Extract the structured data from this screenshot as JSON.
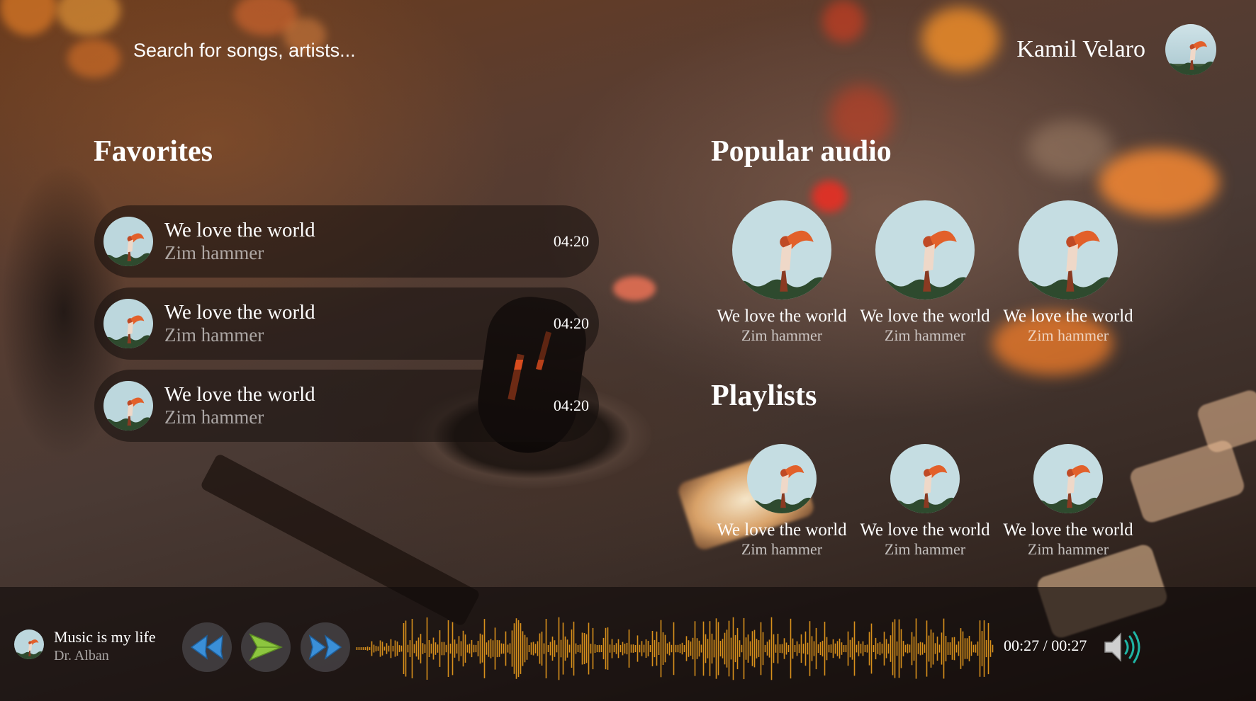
{
  "header": {
    "search_placeholder": "Search for songs, artists...",
    "user_name": "Kamil Velaro"
  },
  "favorites": {
    "title": "Favorites",
    "items": [
      {
        "title": "We love the world",
        "artist": "Zim hammer",
        "duration": "04:20"
      },
      {
        "title": "We love the world",
        "artist": "Zim hammer",
        "duration": "04:20"
      },
      {
        "title": "We love the world",
        "artist": "Zim hammer",
        "duration": "04:20"
      }
    ]
  },
  "popular": {
    "title": "Popular audio",
    "items": [
      {
        "title": "We love the world",
        "artist": "Zim hammer"
      },
      {
        "title": "We love the world",
        "artist": "Zim hammer"
      },
      {
        "title": "We love the world",
        "artist": "Zim hammer"
      }
    ]
  },
  "playlists": {
    "title": "Playlists",
    "items": [
      {
        "title": "We love the world",
        "artist": "Zim hammer"
      },
      {
        "title": "We love the world",
        "artist": "Zim hammer"
      },
      {
        "title": "We love the world",
        "artist": "Zim hammer"
      }
    ]
  },
  "player": {
    "track_title": "Music is my life",
    "track_artist": "Dr. Alban",
    "time": "00:27 / 00:27",
    "progress": 1.0,
    "controls": {
      "rewind": "rewind-icon",
      "play": "play-icon",
      "forward": "fast-forward-icon",
      "volume": "volume-icon"
    },
    "colors": {
      "waveform": "#d8901c",
      "play": "#8dc63f",
      "skip": "#3a8fd8",
      "volume_wave": "#1fb5a5"
    }
  }
}
